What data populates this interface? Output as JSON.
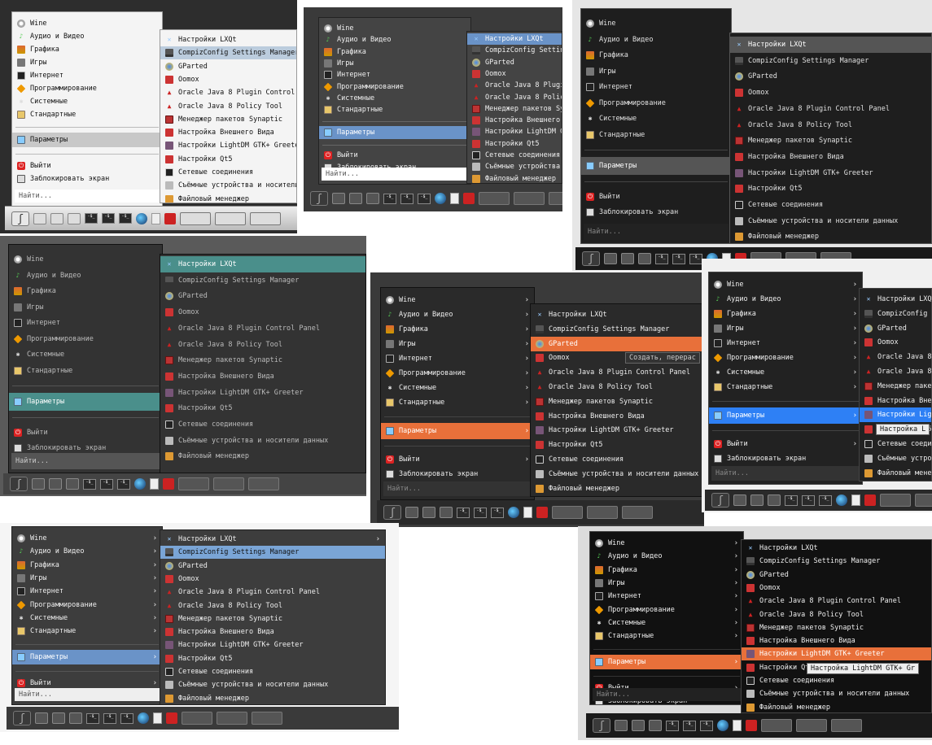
{
  "main_menu": {
    "categories": [
      {
        "label": "Wine",
        "icon": "wine-glass-icon"
      },
      {
        "label": "Аудио и Видео",
        "icon": "music-note-icon"
      },
      {
        "label": "Графика",
        "icon": "palette-icon"
      },
      {
        "label": "Игры",
        "icon": "gamepad-icon"
      },
      {
        "label": "Интернет",
        "icon": "network-monitor-icon"
      },
      {
        "label": "Программирование",
        "icon": "diamond-icon"
      },
      {
        "label": "Системные",
        "icon": "gear-icon"
      },
      {
        "label": "Стандартные",
        "icon": "notepad-icon"
      }
    ],
    "preferences": {
      "label": "Параметры",
      "icon": "preferences-icon"
    },
    "exit": {
      "label": "Выйти",
      "icon": "power-icon"
    },
    "lock": {
      "label": "Заблокировать экран",
      "icon": "lock-icon"
    },
    "search_placeholder": "Найти..."
  },
  "submenu": {
    "items": [
      {
        "label": "Настройки LXQt",
        "icon": "lxqt-settings-icon"
      },
      {
        "label": "CompizConfig Settings Manager",
        "icon": "compiz-icon"
      },
      {
        "label": "GParted",
        "icon": "gparted-icon"
      },
      {
        "label": "Oomox",
        "icon": "oomox-icon"
      },
      {
        "label": "Oracle Java 8 Plugin Control Panel",
        "icon": "java-icon"
      },
      {
        "label": "Oracle Java 8 Policy Tool",
        "icon": "java-icon"
      },
      {
        "label": "Менеджер пакетов Synaptic",
        "icon": "synaptic-icon"
      },
      {
        "label": "Настройка Внешнего Вида",
        "icon": "appearance-icon"
      },
      {
        "label": "Настройки LightDM GTK+ Greeter",
        "icon": "lightdm-icon"
      },
      {
        "label": "Настройки Qt5",
        "icon": "qt-icon"
      },
      {
        "label": "Сетевые соединения",
        "icon": "network-icon"
      },
      {
        "label": "Съёмные устройства и носители данных",
        "icon": "removable-drive-icon"
      },
      {
        "label": "Файловый менеджер",
        "icon": "file-manager-icon"
      }
    ]
  },
  "tooltips": {
    "gparted": "Создать, перерас",
    "lightdm": "Настройка LightDM GTK+ Gr",
    "lightdm_short": "Настройка L"
  },
  "taskbar": {
    "monitor_label": "-$_"
  },
  "colors": {
    "accent_blue": "#6a93c8",
    "accent_teal": "#4a8f8b",
    "accent_orange": "#e8703a",
    "accent_bright_blue": "#2e80f5",
    "dark_bg": "#1f1f1f",
    "grey_bg": "#4a4a4a"
  }
}
